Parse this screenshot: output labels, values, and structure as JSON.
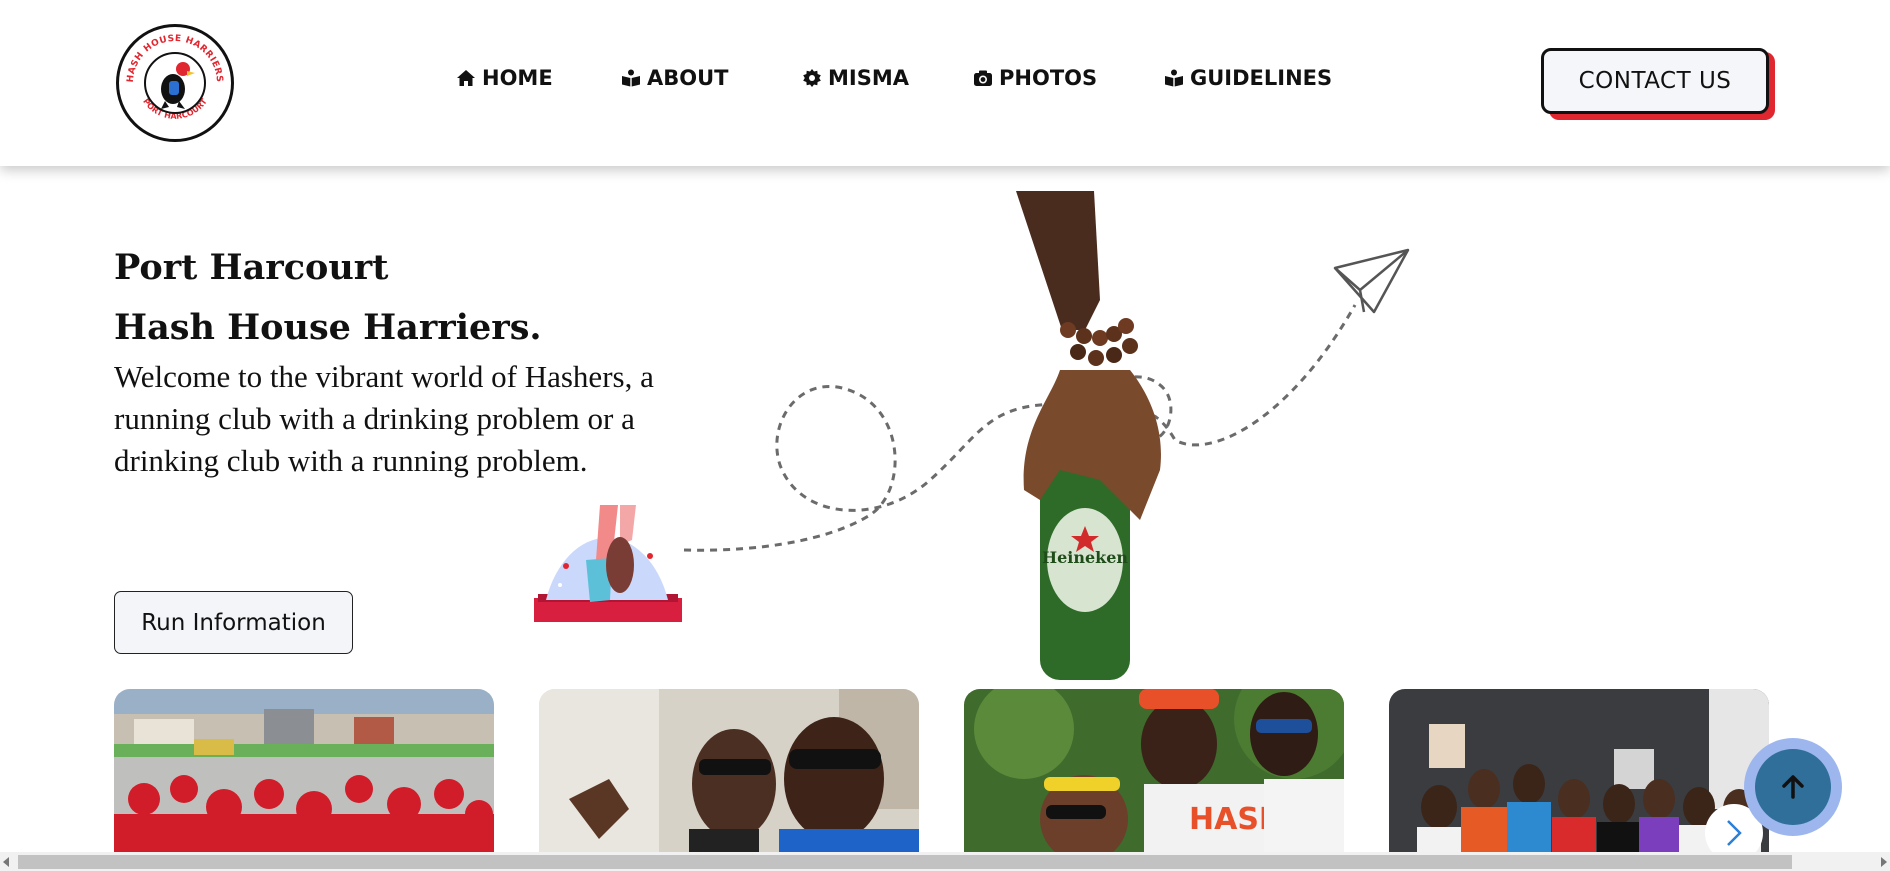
{
  "logo": {
    "text_top": "HASH HOUSE HARRIERS",
    "text_bottom": "PORT HARCOURT",
    "accent": "#e0262f"
  },
  "nav": {
    "items": [
      {
        "label": "HOME",
        "icon": "home-icon"
      },
      {
        "label": "ABOUT",
        "icon": "book-reader-icon"
      },
      {
        "label": "MISMA",
        "icon": "gear-icon"
      },
      {
        "label": "PHOTOS",
        "icon": "camera-icon"
      },
      {
        "label": "GUIDELINES",
        "icon": "book-reader-icon"
      }
    ],
    "contact_label": "CONTACT US"
  },
  "hero": {
    "title_line1": "Port Harcourt",
    "title_line2": "Hash House Harriers.",
    "text": "Welcome to the vibrant world of Hashers, a running club with a drinking problem or a drinking club with a running problem.",
    "run_button": "Run Information",
    "bottle_label": "Heineken"
  },
  "gallery": {
    "photos": [
      {
        "alt": "crowd-in-red-shirts-photo"
      },
      {
        "alt": "two-men-selfie-photo"
      },
      {
        "alt": "group-in-hash-jerseys-photo"
      },
      {
        "alt": "group-outdoors-photo"
      }
    ],
    "next_icon": "chevron-right-icon",
    "top_icon": "arrow-up-icon"
  },
  "colors": {
    "accent_red": "#e0262f",
    "scroll_top_bg": "#2f6f99",
    "scroll_top_ring": "#9db6ee"
  }
}
